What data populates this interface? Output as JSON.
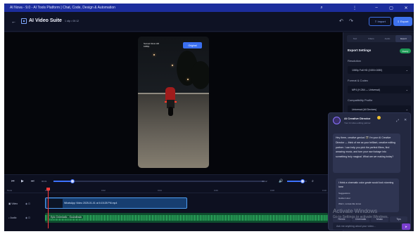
{
  "window": {
    "title": "AI Nova - 9.0 - AI Tools Platform | Chat, Code, Design & Automation"
  },
  "header": {
    "app_title": "AI Video Suite",
    "project_name": "1 clip • 00:12",
    "import_label": "Import",
    "export_label": "Export"
  },
  "preview": {
    "caption_line1": "Sunset Glow HD",
    "caption_line2": "1080p",
    "original_label": "Original"
  },
  "export_panel": {
    "tabs": [
      "Text",
      "Filters",
      "Audio",
      "Export"
    ],
    "active_tab": "Export",
    "title": "Export Settings",
    "badge": "Ready",
    "fields": [
      {
        "label": "Resolution",
        "value": "1080p Full HD (1920×1080)"
      },
      {
        "label": "Format & Codec",
        "value": "MP4 (H.264 — Universal)"
      },
      {
        "label": "Compatibility Profile",
        "value": "Universal (All Devices)"
      }
    ]
  },
  "chat": {
    "title": "AI Creative Director",
    "subtitle": "Your AI video editing partner",
    "ai_message": "Hey there, creative genius! 🎬 I'm your AI Creative Director — think of me as your brilliant, creative editing partner. I can help you pick the perfect filters, find amazing music, and turn your raw footage into something truly magical. What are we making today?",
    "user_message": "I think a cinematic color grade would look stunning here",
    "suggestions_label": "Suggestions",
    "suggestion_1": "Golden Hour",
    "suggestion_2": "Warm, sunset-like tones",
    "actions": [
      "Remix",
      "Cinematic",
      "Music",
      "Tips"
    ],
    "input_placeholder": "Ask me anything about your video..."
  },
  "playback": {
    "current_time": "00:01",
    "duration": "00:12",
    "progress": 0.09,
    "volume": 0.8
  },
  "timeline": {
    "tools_label": "Tools",
    "ruler": [
      "0:00",
      "0:02",
      "0:04",
      "0:06",
      "0:08",
      "0:10",
      "0:12"
    ],
    "tracks": [
      {
        "label": "Video",
        "clip": "WhatsApp Video 2025-01-01 at 6:15:28 PM.mp4"
      },
      {
        "label": "Audio",
        "clip": "Epic Cinematic - Soundtrack"
      }
    ]
  },
  "watermark": {
    "line1": "Activate Windows",
    "line2": "Go to Settings to activate Windows."
  }
}
